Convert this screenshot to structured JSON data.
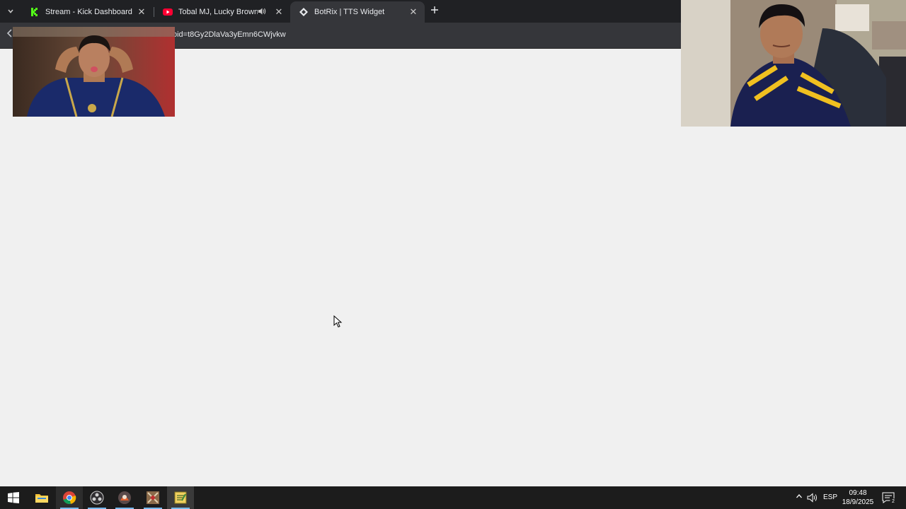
{
  "browser": {
    "tabs": [
      {
        "title": "Stream - Kick Dashboard",
        "icon": "kick-icon",
        "active": false
      },
      {
        "title": "Tobal MJ, Lucky Brown - Ti",
        "icon": "youtube-icon",
        "active": false,
        "playing_audio": true
      },
      {
        "title": "BotRix | TTS Widget",
        "icon": "botrix-icon",
        "active": true
      }
    ],
    "url_fragment": "oid=t8Gy2DlaVa3yEmn6CWjvkw"
  },
  "taskbar": {
    "apps": [
      "windows-start-icon",
      "file-explorer-icon",
      "chrome-icon",
      "obs-icon",
      "app-icon",
      "game-icon",
      "notepad-icon"
    ],
    "language": "ESP",
    "time": "09:48",
    "date": "18/9/2025",
    "notification_count": "2"
  },
  "colors": {
    "tabbar_bg": "#202124",
    "toolbar_bg": "#35363a",
    "page_bg": "#f0f0f0",
    "taskbar_bg": "#1c1c1c",
    "kick_green": "#53fc18",
    "youtube_red": "#ff0033"
  }
}
